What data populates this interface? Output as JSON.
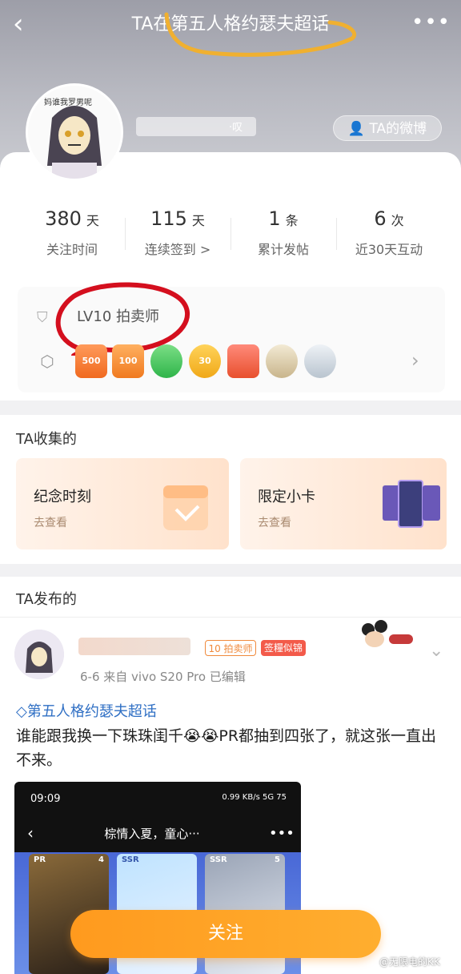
{
  "header": {
    "title": "TA在第五人格约瑟夫超话",
    "back_icon": "chevron-left-icon",
    "more_icon": "more-dots-icon",
    "nickname_suffix": "·叹",
    "weibo_button": "TA的微博"
  },
  "stats": [
    {
      "value": "380",
      "unit": "天",
      "label": "关注时间"
    },
    {
      "value": "115",
      "unit": "天",
      "label": "连续签到 >"
    },
    {
      "value": "1",
      "unit": "条",
      "label": "累计发帖"
    },
    {
      "value": "6",
      "unit": "次",
      "label": "近30天互动"
    }
  ],
  "level": {
    "text": "LV10 拍卖师"
  },
  "badges": [
    "500",
    "100",
    "",
    "30",
    "",
    "",
    ""
  ],
  "collection": {
    "title": "TA收集的",
    "cards": [
      {
        "name": "纪念时刻",
        "sub": "去查看"
      },
      {
        "name": "限定小卡",
        "sub": "去查看"
      }
    ]
  },
  "posts": {
    "title": "TA发布的",
    "item": {
      "tag_level": "10 拍卖师",
      "tag_badge": "签糧似锦",
      "meta": "6-6  来自 vivo S20 Pro  已编辑",
      "topic": "第五人格约瑟夫超话",
      "body": "谁能跟我换一下珠珠闺千😭😭PR都抽到四张了，就这张一直出不来。",
      "screenshot": {
        "time": "09:09",
        "status": "0.99 KB/s  5G  75",
        "title": "棕情入夏，童心···",
        "cards": [
          "PR",
          "SSR",
          "SSR"
        ],
        "counts": [
          "4",
          "",
          "5"
        ]
      }
    }
  },
  "follow_button": "关注",
  "watermark": "@无限电的KK",
  "colors": {
    "accent": "#ff9a1e",
    "level_ring": "#d40f1e",
    "title_mark": "#f0b030",
    "topic": "#2f6fc4"
  }
}
